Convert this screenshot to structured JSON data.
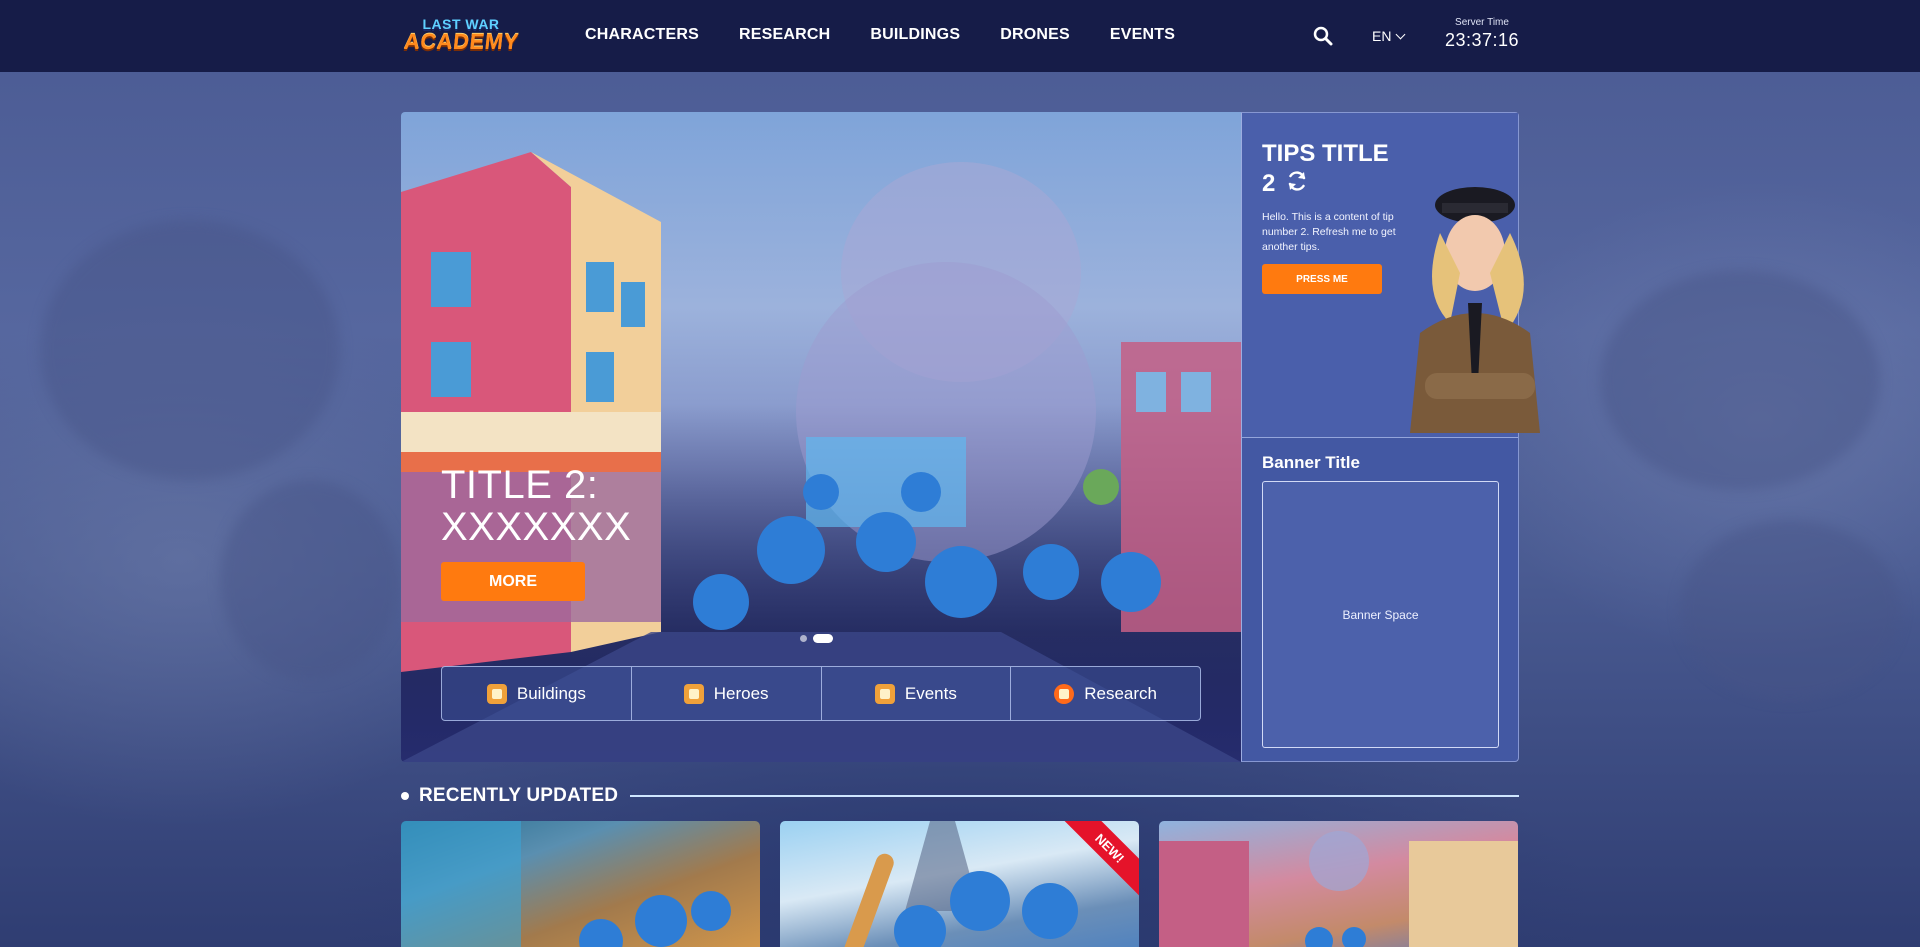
{
  "brand": {
    "line1": "LAST WAR",
    "line2": "ACADEMY"
  },
  "nav": [
    "CHARACTERS",
    "RESEARCH",
    "BUILDINGS",
    "DRONES",
    "EVENTS"
  ],
  "language": "EN",
  "server": {
    "label": "Server Time",
    "time": "23:37:16"
  },
  "hero": {
    "title_line1": "TITLE 2:",
    "title_line2": "XXXXXXX",
    "more_label": "MORE",
    "slides_total": 2,
    "active_slide": 2
  },
  "quick_links": [
    {
      "label": "Buildings",
      "icon": "buildings-icon"
    },
    {
      "label": "Heroes",
      "icon": "heroes-icon"
    },
    {
      "label": "Events",
      "icon": "events-icon"
    },
    {
      "label": "Research",
      "icon": "research-icon"
    }
  ],
  "tips": {
    "title_line1": "TIPS TITLE",
    "title_line2": "2",
    "text": "Hello. This is a content of tip number 2. Refresh me to get another tips.",
    "button": "PRESS ME"
  },
  "banner": {
    "title": "Banner Title",
    "placeholder": "Banner Space"
  },
  "recent": {
    "heading": "RECENTLY UPDATED",
    "cards": [
      {
        "badge": ""
      },
      {
        "badge": "NEW!"
      },
      {
        "badge": ""
      }
    ]
  },
  "colors": {
    "accent": "#ff7a0f",
    "header": "#161c48",
    "panel": "#4a5fab",
    "badge": "#e5132a"
  }
}
